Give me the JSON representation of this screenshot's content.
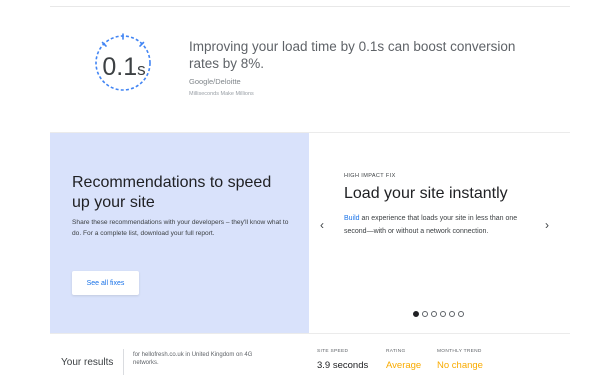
{
  "stat": {
    "value": "0.1",
    "unit": "s",
    "headline": "Improving your load time by 0.1s can boost conversion rates by 8%.",
    "source": "Google/Deloitte",
    "source_sub": "Milliseconds Make Millions"
  },
  "recommendations": {
    "title": "Recommendations to speed up your site",
    "description": "Share these recommendations with your developers – they'll know what to do. For a complete list, download your full report.",
    "button_label": "See all fixes"
  },
  "fix_carousel": {
    "eyebrow": "HIGH IMPACT FIX",
    "title": "Load your site instantly",
    "desc_link": "Build",
    "desc_rest": " an experience that loads your site in less than one second—with or without a network connection.",
    "prev_icon": "‹",
    "next_icon": "›",
    "slide_count": 6,
    "active_index": 0
  },
  "results": {
    "label": "Your results",
    "context": "for hellofresh.co.uk in United Kingdom on 4G networks.",
    "metrics": [
      {
        "label": "SITE SPEED",
        "value": "3.9  seconds",
        "color": "#202124"
      },
      {
        "label": "RATING",
        "value": "Average",
        "color": "#f9ab00"
      },
      {
        "label": "MONTHLY TREND",
        "value": "No change",
        "color": "#f9ab00"
      }
    ]
  },
  "colors": {
    "accent": "#1a73e8",
    "panel": "#d9e2fb",
    "warning": "#f9ab00"
  },
  "icons": {
    "gauge": "stopwatch-gauge-icon",
    "prev": "chevron-left-icon",
    "next": "chevron-right-icon"
  }
}
